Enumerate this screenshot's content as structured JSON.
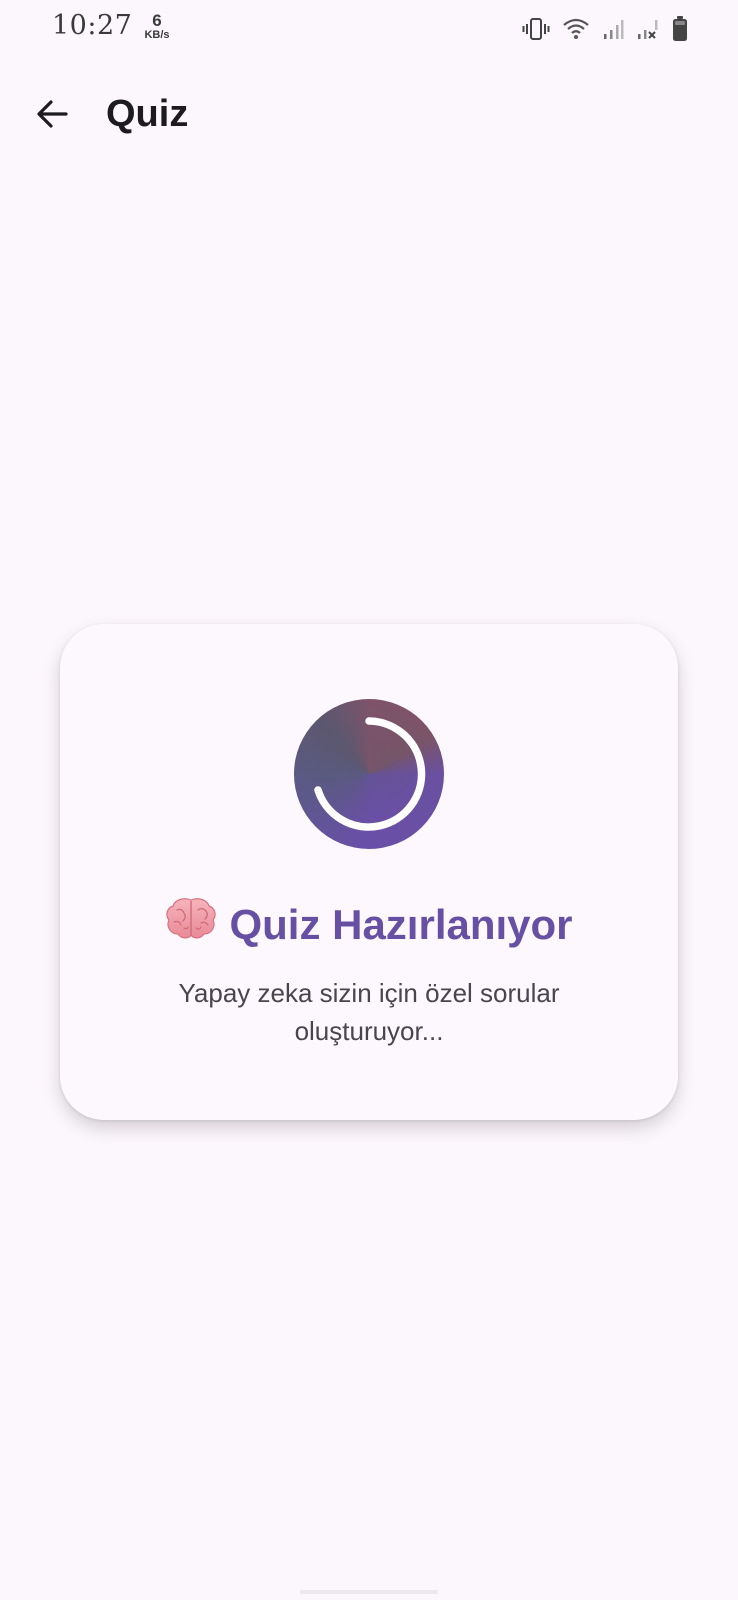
{
  "status_bar": {
    "time": "10:27",
    "speed_value": "6",
    "speed_unit": "KB/s",
    "icons": [
      "vibrate-icon",
      "wifi-icon",
      "signal-icon",
      "signal-no-service-icon",
      "battery-icon"
    ]
  },
  "app_bar": {
    "back_icon": "arrow-back-icon",
    "title": "Quiz"
  },
  "loading_card": {
    "emoji": "🧠",
    "title": "Quiz Hazırlanıyor",
    "message": "Yapay zeka sizin için özel sorular oluşturuyor..."
  },
  "colors": {
    "primary": "#6750A4",
    "background": "#FCF7FD",
    "card": "#FDF8FD",
    "text_secondary": "#49454F"
  }
}
